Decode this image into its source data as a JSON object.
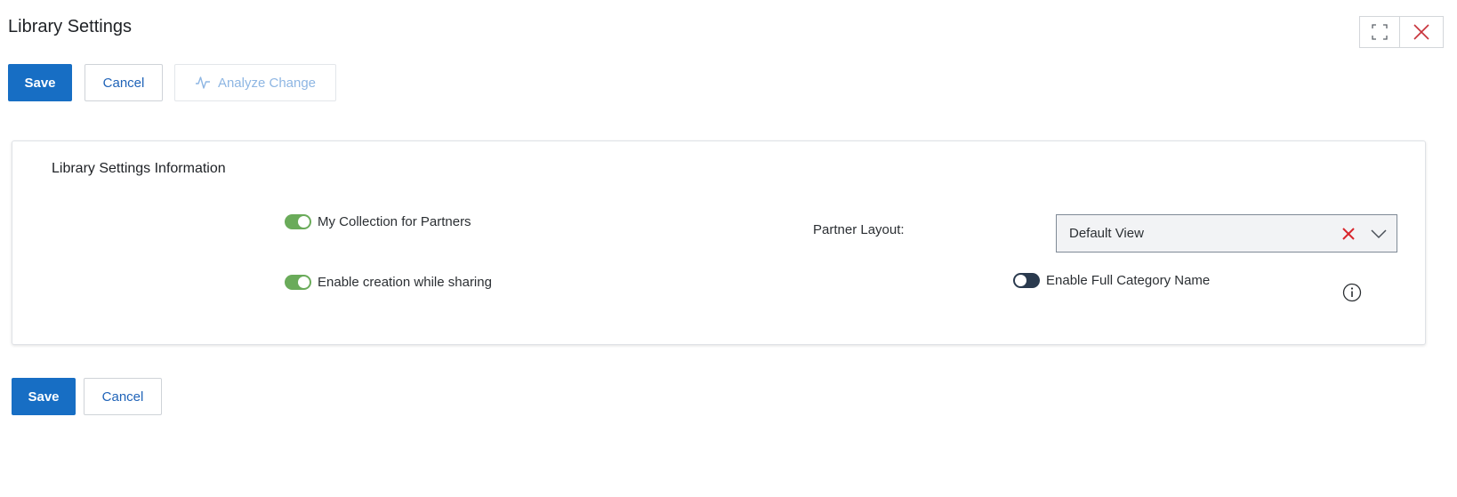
{
  "header": {
    "title": "Library Settings"
  },
  "window_controls": {
    "expand_icon": "expand-icon",
    "close_icon": "close-icon"
  },
  "toolbar": {
    "save_label": "Save",
    "cancel_label": "Cancel",
    "analyze_label": "Analyze Change",
    "analyze_icon": "activity-pulse-icon"
  },
  "card": {
    "title": "Library Settings Information",
    "toggles": [
      {
        "label": "My Collection for Partners",
        "state": "on"
      },
      {
        "label": "Enable creation while sharing",
        "state": "on"
      },
      {
        "label": "Enable Full Category Name",
        "state": "off"
      }
    ],
    "partner_layout": {
      "label": "Partner Layout:",
      "value": "Default View"
    }
  },
  "footer": {
    "save_label": "Save",
    "cancel_label": "Cancel"
  },
  "colors": {
    "primary": "#176ec4",
    "toggle_on": "#6aab5a",
    "toggle_off": "#2a3a4e",
    "clear_x": "#d9262c",
    "close_x": "#c8323a"
  }
}
